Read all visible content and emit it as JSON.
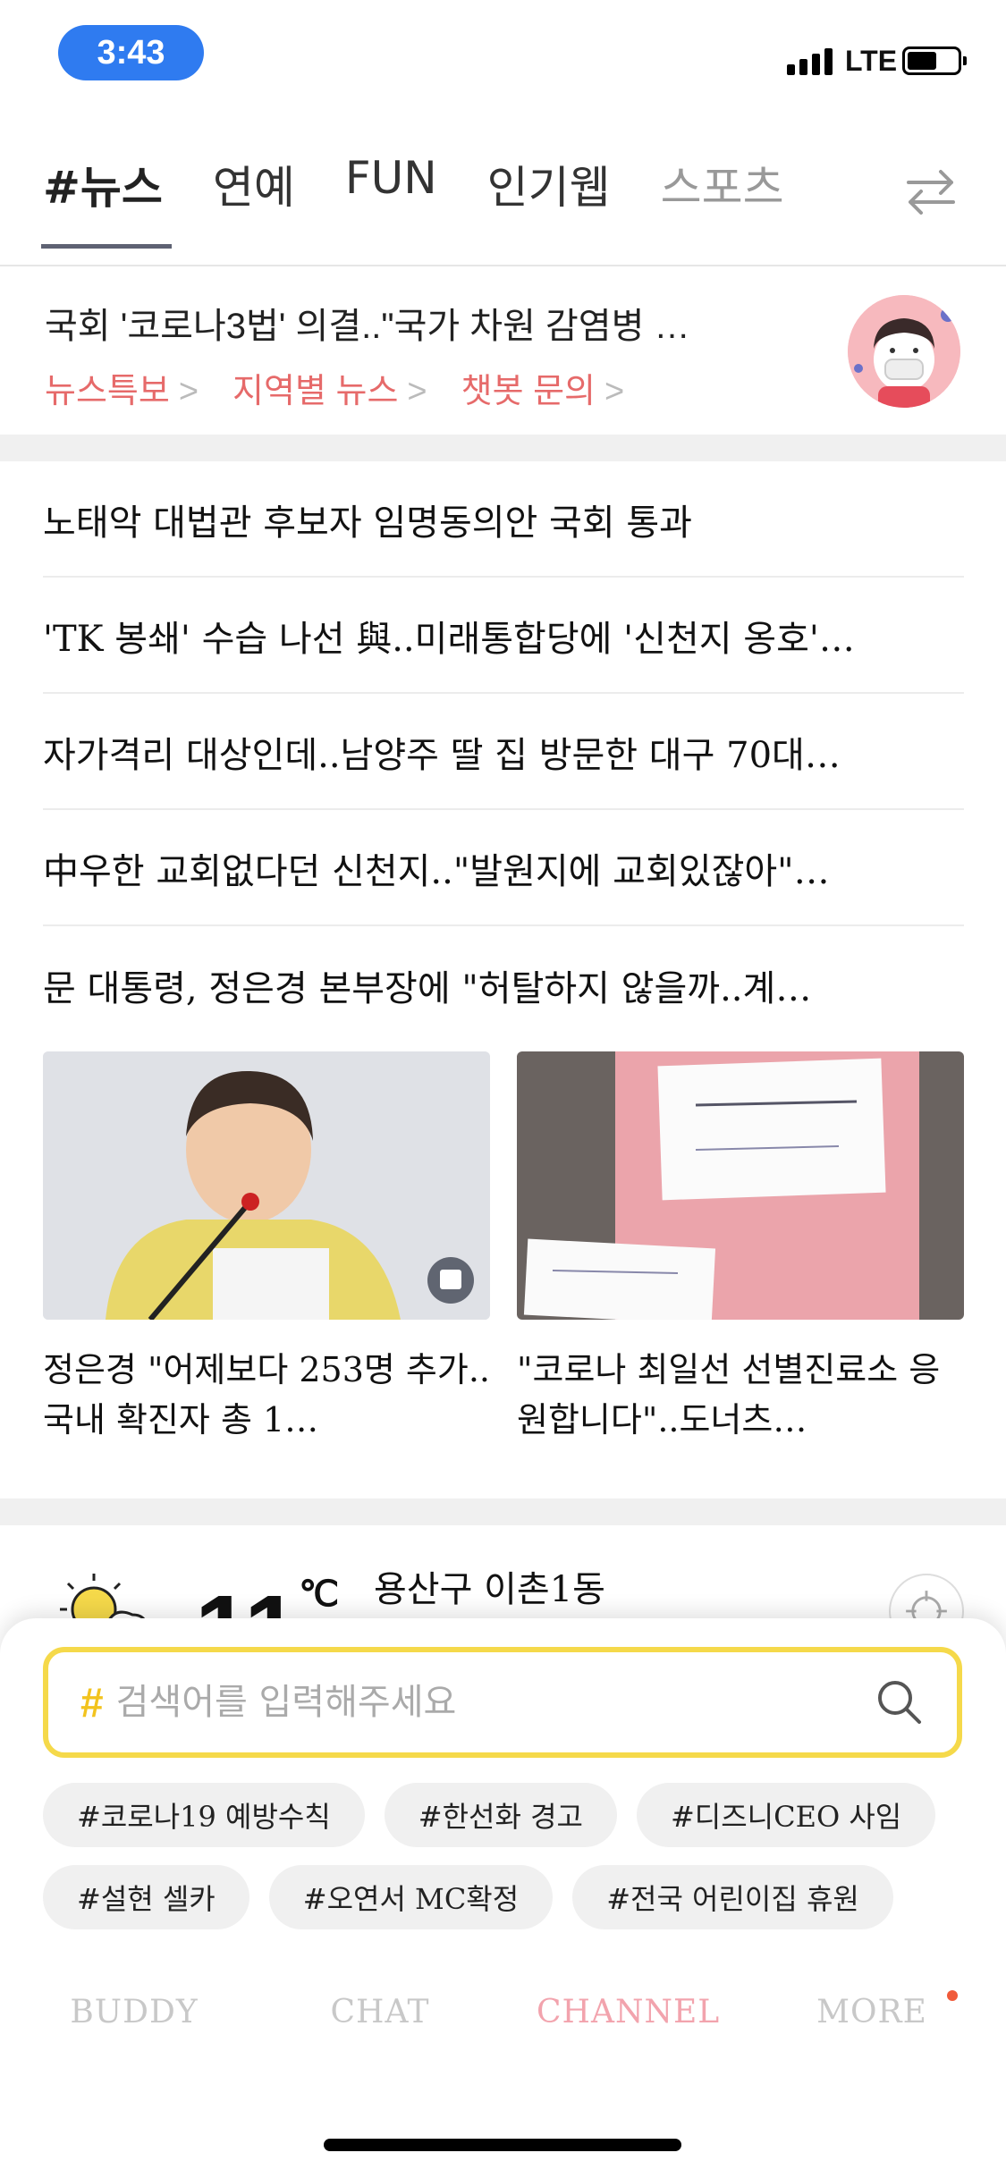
{
  "status_bar": {
    "time": "3:43",
    "network": "LTE",
    "colors": {
      "time_pill": "#2f7bf0"
    }
  },
  "tabs": [
    {
      "label": "#뉴스",
      "active": true
    },
    {
      "label": "연예",
      "active": false
    },
    {
      "label": "FUN",
      "active": false
    },
    {
      "label": "인기웹",
      "active": false
    },
    {
      "label": "스포츠",
      "active": false
    }
  ],
  "headline": {
    "text": "국회 '코로나3법' 의결..\"국가 차원 감염병 …",
    "links": [
      "뉴스특보",
      "지역별 뉴스",
      "챗봇 문의"
    ]
  },
  "news": [
    "노태악 대법관 후보자 임명동의안 국회 통과",
    "'TK 봉쇄' 수습 나선 與..미래통합당에 '신천지 옹호'…",
    "자가격리 대상인데..남양주 딸 집 방문한 대구 70대…",
    "中우한 교회없다던 신천지..\"발원지에 교회있잖아\"…",
    "문 대통령, 정은경 본부장에 \"허탈하지 않을까..계…"
  ],
  "cards": [
    {
      "caption": "정은경 \"어제보다 253명 추가..국내 확진자 총 1…"
    },
    {
      "caption": "\"코로나 최일선 선별진료소 응원합니다\"..도너츠…"
    }
  ],
  "weather": {
    "temp": "11",
    "unit": "℃",
    "location": "용산구 이촌1동"
  },
  "search": {
    "hash": "#",
    "placeholder": "검색어를 입력해주세요"
  },
  "chips": [
    "#코로나19 예방수칙",
    "#한선화 경고",
    "#디즈니CEO 사임",
    "#설현 셀카",
    "#오연서 MC확정",
    "#전국 어린이집 휴원"
  ],
  "bottom_nav": [
    {
      "label": "BUDDY",
      "active": false
    },
    {
      "label": "CHAT",
      "active": false
    },
    {
      "label": "CHANNEL",
      "active": true
    },
    {
      "label": "MORE",
      "active": false
    }
  ],
  "icons": [
    "signal-icon",
    "battery-icon",
    "swap-icon",
    "search-icon",
    "location-icon",
    "weather-icon"
  ]
}
